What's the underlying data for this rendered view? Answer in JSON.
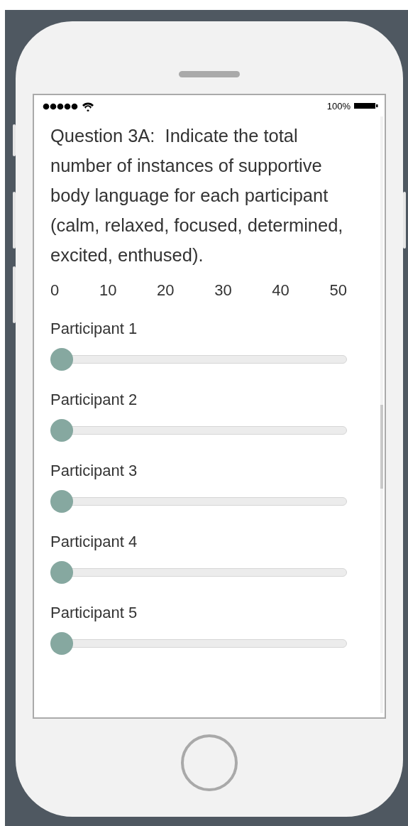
{
  "status_bar": {
    "battery_text": "100%"
  },
  "question": "Question 3A:  Indicate the total number of instances of supportive body language for each participant (calm, relaxed, focused, determined, excited, enthused).",
  "scale_ticks": [
    "0",
    "10",
    "20",
    "30",
    "40",
    "50"
  ],
  "participants": [
    {
      "label": "Participant 1",
      "level": 0
    },
    {
      "label": "Participant 2",
      "level": 0
    },
    {
      "label": "Participant 3",
      "level": 0
    },
    {
      "label": "Participant 4",
      "level": 0
    },
    {
      "label": "Participant 5",
      "level": 0
    }
  ]
}
